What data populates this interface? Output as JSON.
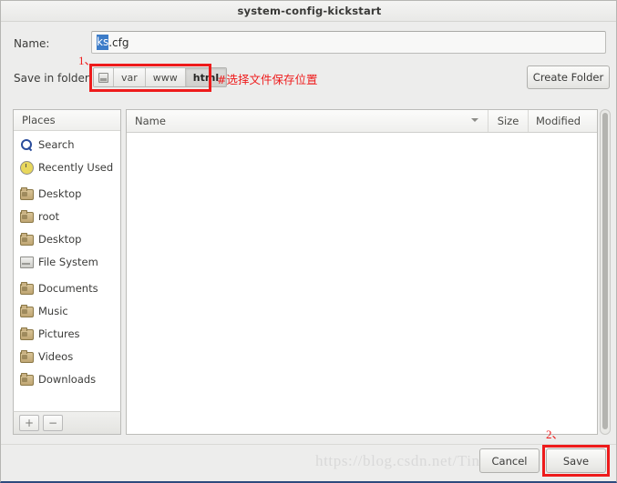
{
  "window": {
    "title": "system-config-kickstart"
  },
  "name_row": {
    "label": "Name:",
    "value_selected": "ks",
    "value_rest": ".cfg",
    "value_full": "ks.cfg"
  },
  "folder_row": {
    "label": "Save in folder:",
    "path_buttons": [
      {
        "label": "",
        "icon": "drive-icon",
        "active": false
      },
      {
        "label": "var",
        "icon": "",
        "active": false
      },
      {
        "label": "www",
        "icon": "",
        "active": false
      },
      {
        "label": "html",
        "icon": "",
        "active": true
      }
    ],
    "create_folder_label": "Create Folder"
  },
  "annotations": {
    "marker_1": "1、",
    "marker_2": "2、",
    "note_chinese": "#选择文件保存位置",
    "highlight_color": "#ee1b1b"
  },
  "places": {
    "header": "Places",
    "items": [
      {
        "label": "Search",
        "icon": "search-icon"
      },
      {
        "label": "Recently Used",
        "icon": "clock-icon"
      },
      {
        "label": "Desktop",
        "icon": "folder-icon"
      },
      {
        "label": "root",
        "icon": "home-folder-icon"
      },
      {
        "label": "Desktop",
        "icon": "folder-icon"
      },
      {
        "label": "File System",
        "icon": "disk-icon"
      },
      {
        "label": "Documents",
        "icon": "folder-icon"
      },
      {
        "label": "Music",
        "icon": "folder-icon"
      },
      {
        "label": "Pictures",
        "icon": "folder-icon"
      },
      {
        "label": "Videos",
        "icon": "folder-icon"
      },
      {
        "label": "Downloads",
        "icon": "folder-icon"
      }
    ],
    "add_button": "+",
    "remove_button": "−"
  },
  "file_list": {
    "columns": {
      "name": "Name",
      "size": "Size",
      "modified": "Modified"
    },
    "rows": []
  },
  "actions": {
    "cancel_label": "Cancel",
    "save_label": "Save"
  },
  "watermark": {
    "text": "https://blog.csdn.net/Ting_smile"
  }
}
